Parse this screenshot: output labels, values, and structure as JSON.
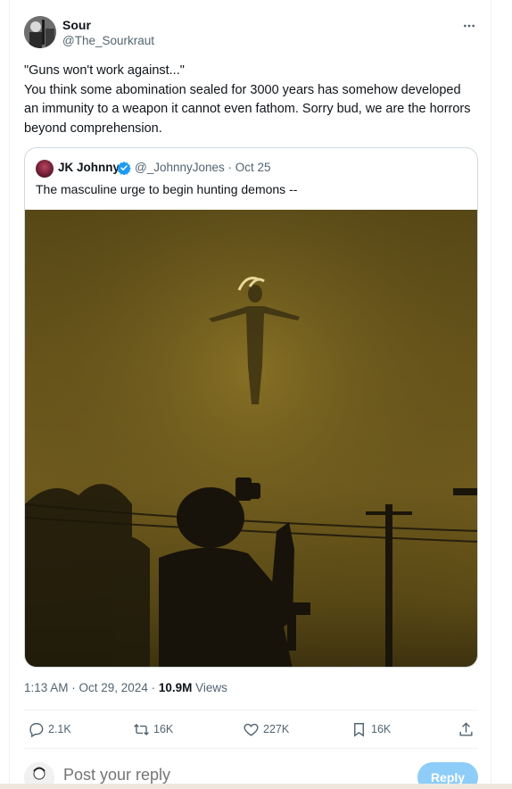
{
  "author": {
    "display_name": "Sour",
    "handle": "@The_Sourkraut"
  },
  "tweet": {
    "text": "\"Guns won't work against...\"\nYou think some abomination sealed for 3000 years has somehow developed an immunity to a weapon it cannot even fathom. Sorry bud, we are the horrors beyond comprehension."
  },
  "quoted_tweet": {
    "display_name": "JK Johnny",
    "handle_and_date": "@_JohnnyJones · Oct 25",
    "text": "The masculine urge to begin hunting demons --"
  },
  "meta": {
    "timestamp": "1:13 AM · Oct 29, 2024 · ",
    "views_count": "10.9M",
    "views_label": " Views"
  },
  "actions": {
    "replies": "2.1K",
    "reposts": "16K",
    "likes": "227K",
    "bookmarks": "16K"
  },
  "reply_box": {
    "placeholder": "Post your reply",
    "button_label": "Reply"
  },
  "colors": {
    "accent": "#1d9bf0",
    "reply_button_disabled": "#8ecdf8",
    "secondary_text": "#536471"
  },
  "icons": {
    "more": "more-horizontal-icon",
    "verified": "verified-badge-icon",
    "reply": "reply-bubble-icon",
    "repost": "repost-arrows-icon",
    "like": "heart-icon",
    "bookmark": "bookmark-icon",
    "share": "share-upload-icon"
  }
}
